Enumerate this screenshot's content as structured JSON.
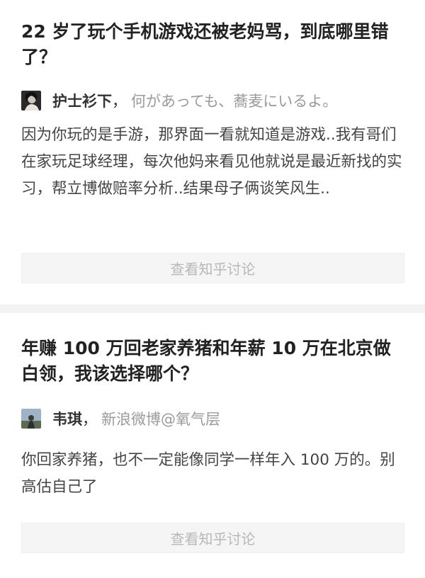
{
  "feed": {
    "cards": [
      {
        "question_title": "22 岁了玩个手机游戏还被老妈骂，到底哪里错了？",
        "author": {
          "name": "护士衫下",
          "separator": "，",
          "bio": "何があっても、蕎麦にいるよ。",
          "avatar_icon": "avatar-photo-icon"
        },
        "answer": "因为你玩的是手游，那界面一看就知道是游戏..我有哥们在家玩足球经理，每次他妈来看见他就说是最近新找的实习，帮立博做赔率分析..结果母子俩谈笑风生..",
        "view_button_label": "查看知乎讨论"
      },
      {
        "question_title": "年赚 100 万回老家养猪和年薪 10 万在北京做白领，我该选择哪个？",
        "author": {
          "name": "韦琪",
          "separator": "，",
          "bio": "新浪微博@氧气层",
          "avatar_icon": "avatar-photo-icon"
        },
        "answer": "你回家养猪，也不一定能像同学一样年入 100 万的。别高估自己了",
        "view_button_label": "查看知乎讨论"
      }
    ]
  },
  "colors": {
    "title": "#222222",
    "body_text": "#444444",
    "bio_text": "#9a9a9a",
    "button_bg": "#f5f5f5",
    "button_text": "#b8b8b8",
    "section_divider": "#f3f3f3"
  }
}
